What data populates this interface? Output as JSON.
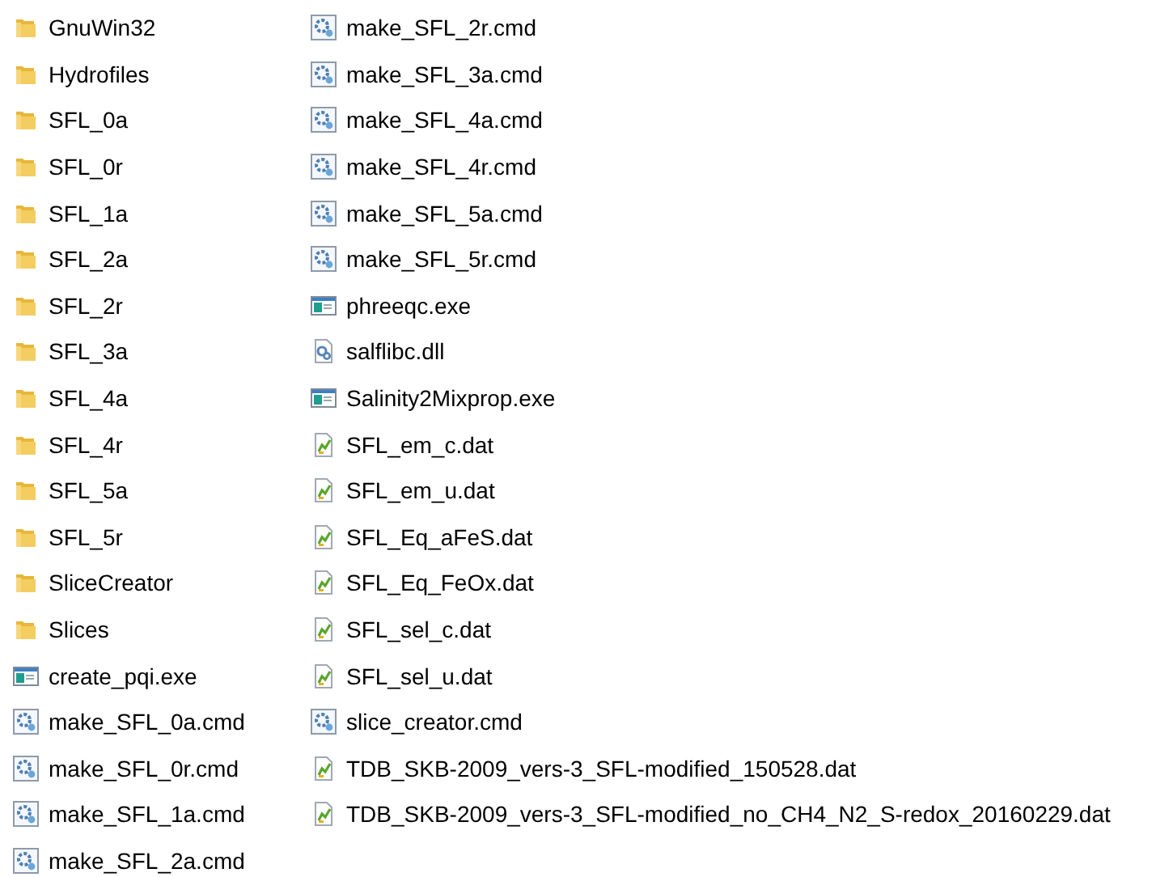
{
  "files": [
    {
      "name": "GnuWin32",
      "kind": "folder"
    },
    {
      "name": "Hydrofiles",
      "kind": "folder"
    },
    {
      "name": "SFL_0a",
      "kind": "folder"
    },
    {
      "name": "SFL_0r",
      "kind": "folder"
    },
    {
      "name": "SFL_1a",
      "kind": "folder"
    },
    {
      "name": "SFL_2a",
      "kind": "folder"
    },
    {
      "name": "SFL_2r",
      "kind": "folder"
    },
    {
      "name": "SFL_3a",
      "kind": "folder"
    },
    {
      "name": "SFL_4a",
      "kind": "folder"
    },
    {
      "name": "SFL_4r",
      "kind": "folder"
    },
    {
      "name": "SFL_5a",
      "kind": "folder"
    },
    {
      "name": "SFL_5r",
      "kind": "folder"
    },
    {
      "name": "SliceCreator",
      "kind": "folder"
    },
    {
      "name": "Slices",
      "kind": "folder"
    },
    {
      "name": "create_pqi.exe",
      "kind": "exe"
    },
    {
      "name": "make_SFL_0a.cmd",
      "kind": "cmd"
    },
    {
      "name": "make_SFL_0r.cmd",
      "kind": "cmd"
    },
    {
      "name": "make_SFL_1a.cmd",
      "kind": "cmd"
    },
    {
      "name": "make_SFL_2a.cmd",
      "kind": "cmd"
    },
    {
      "name": "make_SFL_2r.cmd",
      "kind": "cmd"
    },
    {
      "name": "make_SFL_3a.cmd",
      "kind": "cmd"
    },
    {
      "name": "make_SFL_4a.cmd",
      "kind": "cmd"
    },
    {
      "name": "make_SFL_4r.cmd",
      "kind": "cmd"
    },
    {
      "name": "make_SFL_5a.cmd",
      "kind": "cmd"
    },
    {
      "name": "make_SFL_5r.cmd",
      "kind": "cmd"
    },
    {
      "name": "phreeqc.exe",
      "kind": "exe"
    },
    {
      "name": "salflibc.dll",
      "kind": "dll"
    },
    {
      "name": "Salinity2Mixprop.exe",
      "kind": "exe"
    },
    {
      "name": "SFL_em_c.dat",
      "kind": "dat"
    },
    {
      "name": "SFL_em_u.dat",
      "kind": "dat"
    },
    {
      "name": "SFL_Eq_aFeS.dat",
      "kind": "dat"
    },
    {
      "name": "SFL_Eq_FeOx.dat",
      "kind": "dat"
    },
    {
      "name": "SFL_sel_c.dat",
      "kind": "dat"
    },
    {
      "name": "SFL_sel_u.dat",
      "kind": "dat"
    },
    {
      "name": "slice_creator.cmd",
      "kind": "cmd"
    },
    {
      "name": "TDB_SKB-2009_vers-3_SFL-modified_150528.dat",
      "kind": "dat"
    },
    {
      "name": "TDB_SKB-2009_vers-3_SFL-modified_no_CH4_N2_S-redox_20160229.dat",
      "kind": "dat"
    }
  ]
}
